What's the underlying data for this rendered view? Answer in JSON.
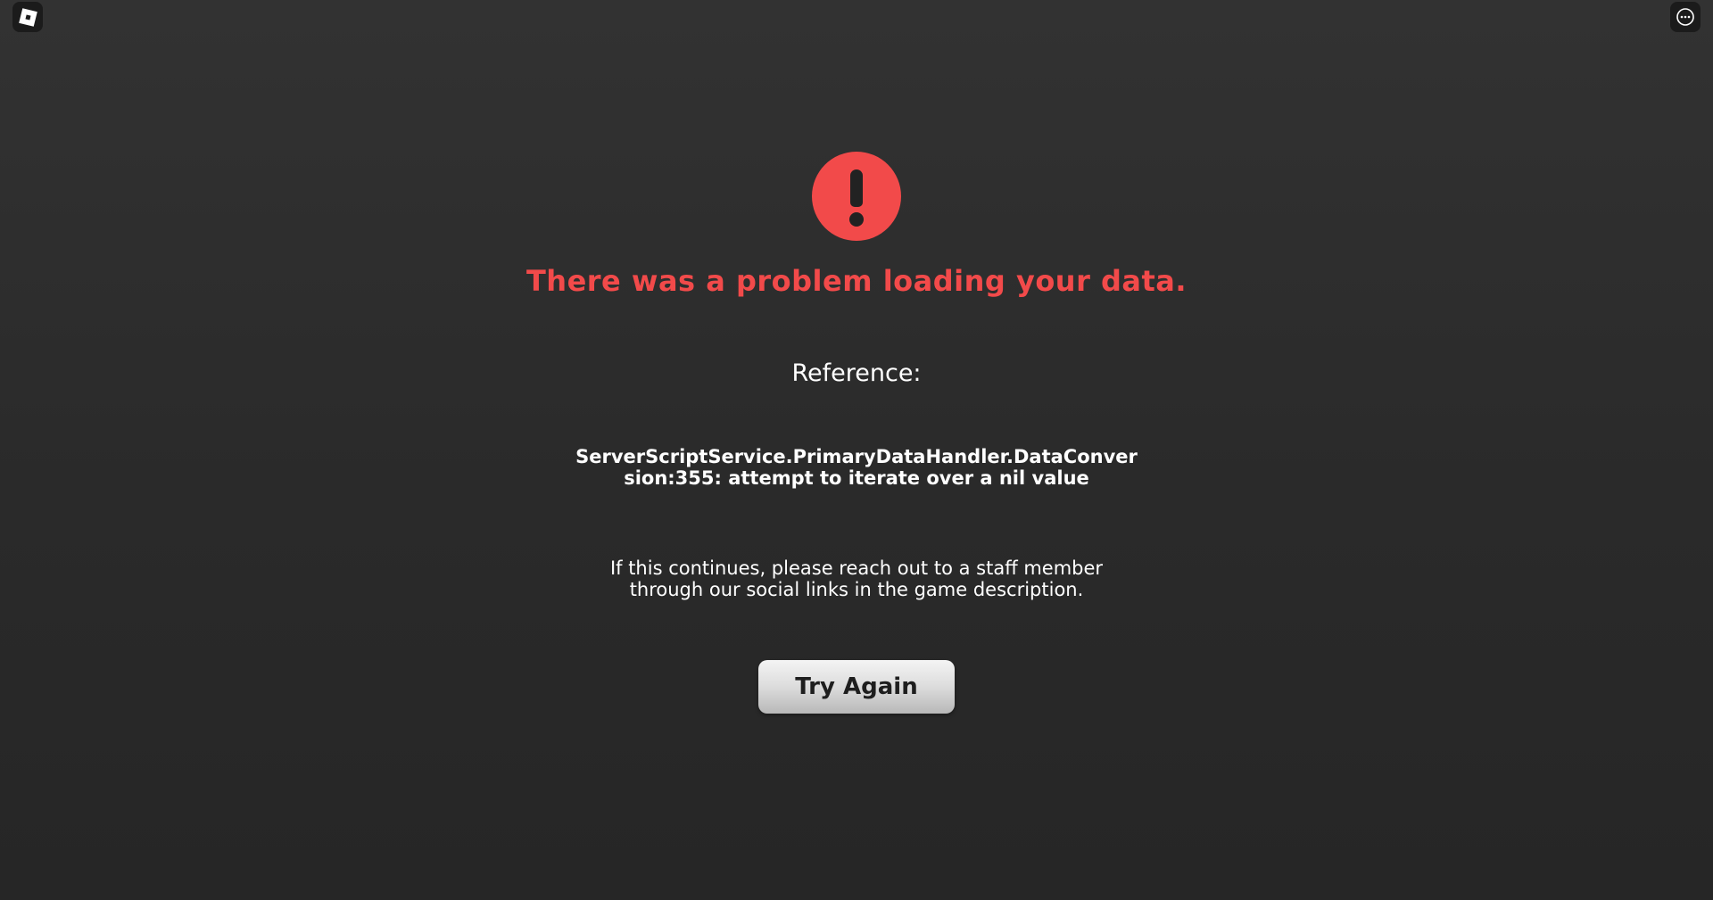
{
  "topbar": {
    "left_icon": "roblox-logo-icon",
    "right_icon": "more-options-icon"
  },
  "error": {
    "icon": "exclamation-circle-icon",
    "accent_color": "#f24a4a",
    "title": "There was a problem loading your data.",
    "reference_label": "Reference:",
    "reference_message": "ServerScriptService.PrimaryDataHandler.DataConversion:355: attempt to iterate over a nil value",
    "help_text": "If this continues, please reach out to a staff member through our social links in the game description."
  },
  "actions": {
    "try_again_label": "Try Again"
  }
}
